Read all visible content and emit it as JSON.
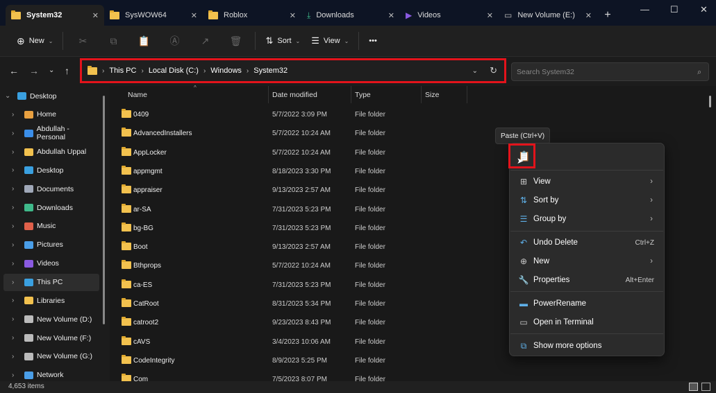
{
  "tabs": [
    {
      "label": "System32",
      "icon": "folder"
    },
    {
      "label": "SysWOW64",
      "icon": "folder"
    },
    {
      "label": "Roblox",
      "icon": "folder"
    },
    {
      "label": "Downloads",
      "icon": "download"
    },
    {
      "label": "Videos",
      "icon": "video"
    },
    {
      "label": "New Volume (E:)",
      "icon": "drive"
    }
  ],
  "toolbar": {
    "new": "New",
    "sort": "Sort",
    "view": "View",
    "more": "•••"
  },
  "breadcrumb": [
    "This PC",
    "Local Disk (C:)",
    "Windows",
    "System32"
  ],
  "search": {
    "placeholder": "Search System32"
  },
  "sidebar": [
    {
      "label": "Desktop",
      "color": "#3aa0e0",
      "top": true
    },
    {
      "label": "Home",
      "color": "#e8a040"
    },
    {
      "label": "Abdullah - Personal",
      "color": "#3b8ee8"
    },
    {
      "label": "Abdullah Uppal",
      "color": "#f2c14e"
    },
    {
      "label": "Desktop",
      "color": "#3aa0e0"
    },
    {
      "label": "Documents",
      "color": "#a0a8b8"
    },
    {
      "label": "Downloads",
      "color": "#3fb98a"
    },
    {
      "label": "Music",
      "color": "#e0604a"
    },
    {
      "label": "Pictures",
      "color": "#4a9ee8"
    },
    {
      "label": "Videos",
      "color": "#8a5ae0"
    },
    {
      "label": "This PC",
      "color": "#3aa0e0",
      "selected": true
    },
    {
      "label": "Libraries",
      "color": "#f2c14e"
    },
    {
      "label": "New Volume (D:)",
      "color": "#bbbbbb"
    },
    {
      "label": "New Volume (F:)",
      "color": "#bbbbbb"
    },
    {
      "label": "New Volume (G:)",
      "color": "#bbbbbb"
    },
    {
      "label": "Network",
      "color": "#4a9ee8"
    }
  ],
  "columns": {
    "name": "Name",
    "date": "Date modified",
    "type": "Type",
    "size": "Size"
  },
  "files": [
    {
      "name": "0409",
      "date": "5/7/2022 3:09 PM",
      "type": "File folder"
    },
    {
      "name": "AdvancedInstallers",
      "date": "5/7/2022 10:24 AM",
      "type": "File folder"
    },
    {
      "name": "AppLocker",
      "date": "5/7/2022 10:24 AM",
      "type": "File folder"
    },
    {
      "name": "appmgmt",
      "date": "8/18/2023 3:30 PM",
      "type": "File folder"
    },
    {
      "name": "appraiser",
      "date": "9/13/2023 2:57 AM",
      "type": "File folder"
    },
    {
      "name": "ar-SA",
      "date": "7/31/2023 5:23 PM",
      "type": "File folder"
    },
    {
      "name": "bg-BG",
      "date": "7/31/2023 5:23 PM",
      "type": "File folder"
    },
    {
      "name": "Boot",
      "date": "9/13/2023 2:57 AM",
      "type": "File folder"
    },
    {
      "name": "Bthprops",
      "date": "5/7/2022 10:24 AM",
      "type": "File folder"
    },
    {
      "name": "ca-ES",
      "date": "7/31/2023 5:23 PM",
      "type": "File folder"
    },
    {
      "name": "CatRoot",
      "date": "8/31/2023 5:34 PM",
      "type": "File folder"
    },
    {
      "name": "catroot2",
      "date": "9/23/2023 8:43 PM",
      "type": "File folder"
    },
    {
      "name": "cAVS",
      "date": "3/4/2023 10:06 AM",
      "type": "File folder"
    },
    {
      "name": "CodeIntegrity",
      "date": "8/9/2023 5:25 PM",
      "type": "File folder"
    },
    {
      "name": "Com",
      "date": "7/5/2023 8:07 PM",
      "type": "File folder"
    }
  ],
  "status": "4,653 items",
  "tooltip": "Paste (Ctrl+V)",
  "menu": [
    {
      "label": "View",
      "icon": "⊞",
      "sub": true,
      "name": "view"
    },
    {
      "label": "Sort by",
      "icon": "⇅",
      "sub": true,
      "name": "sort-by"
    },
    {
      "label": "Group by",
      "icon": "☰",
      "sub": true,
      "name": "group-by"
    },
    {
      "label": "Undo Delete",
      "icon": "↶",
      "shortcut": "Ctrl+Z",
      "name": "undo-delete"
    },
    {
      "label": "New",
      "icon": "⊕",
      "sub": true,
      "name": "new"
    },
    {
      "label": "Properties",
      "icon": "🔧",
      "shortcut": "Alt+Enter",
      "name": "properties"
    },
    {
      "label": "PowerRename",
      "icon": "▬",
      "name": "powerrename"
    },
    {
      "label": "Open in Terminal",
      "icon": "▭",
      "name": "open-in-terminal"
    },
    {
      "label": "Show more options",
      "icon": "⧉",
      "name": "show-more-options"
    }
  ],
  "accent": "#e3131b"
}
